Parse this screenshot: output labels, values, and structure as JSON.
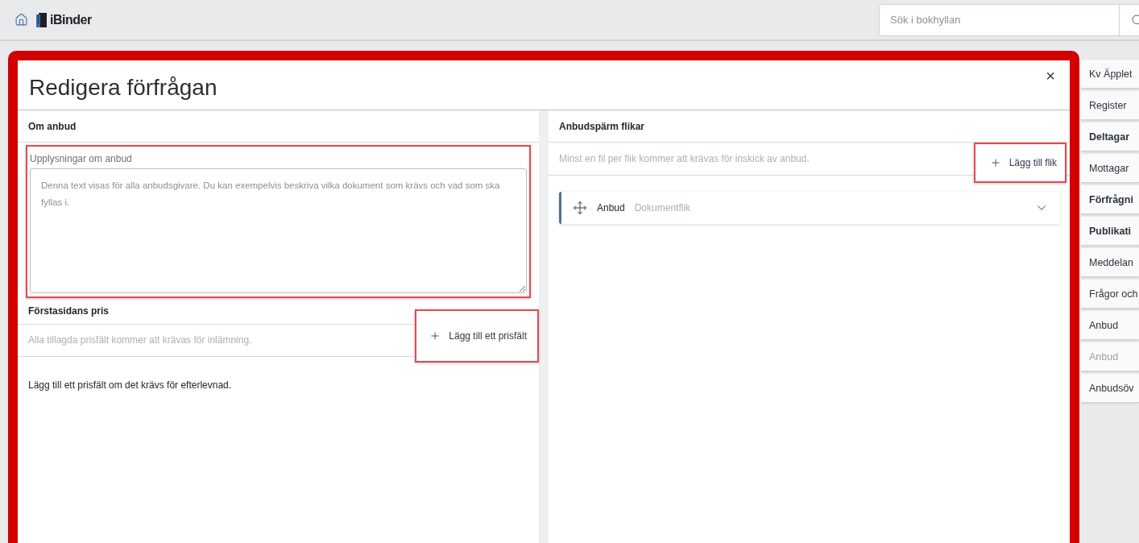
{
  "topbar": {
    "logo": "iBinder",
    "search": {
      "placeholder": "Sök i bokhyllan"
    }
  },
  "dialog": {
    "title": "Redigera förfrågan",
    "close": "×",
    "about": {
      "heading": "Om anbud",
      "field": {
        "label": "Upplysningar om anbud",
        "placeholder": "Denna text visas för alla anbudsgivare. Du kan exempelvis beskriva vilka dokument som krävs och vad som ska fyllas i.",
        "highlighted": true
      }
    },
    "price": {
      "heading": "Förstasidans pris",
      "hint": "Alla tillagda prisfält kommer att krävas för inlämning.",
      "add_button": {
        "label": "Lägg till ett prisfält",
        "highlighted": true
      },
      "empty_text": "Lägg till ett prisfält om det krävs för efterlevnad."
    },
    "binder_tabs": {
      "heading": "Anbudspärm flikar",
      "hint": "Minst en fil per flik kommer att krävas för inskick av anbud.",
      "add_button": {
        "label": "Lägg till flik",
        "highlighted": true
      },
      "tabs": [
        {
          "name": "Anbud",
          "type": "Dokumentflik",
          "expanded": false
        }
      ]
    }
  },
  "sidebar": {
    "items": [
      {
        "label": "Kv Äpplet",
        "bold": false,
        "disabled": false
      },
      {
        "label": "Register",
        "bold": false,
        "disabled": false
      },
      {
        "label": "Deltagar",
        "bold": true,
        "disabled": false
      },
      {
        "label": "Mottagar",
        "bold": false,
        "disabled": false
      },
      {
        "label": "Förfrågni",
        "bold": true,
        "disabled": false
      },
      {
        "label": "Publikati",
        "bold": true,
        "disabled": false
      },
      {
        "label": "Meddelan",
        "bold": false,
        "disabled": false
      },
      {
        "label": "Frågor och",
        "bold": false,
        "disabled": false
      },
      {
        "label": "Anbud",
        "bold": false,
        "disabled": false
      },
      {
        "label": "Anbud",
        "bold": false,
        "disabled": true
      },
      {
        "label": "Anbudsöv",
        "bold": false,
        "disabled": false
      }
    ]
  }
}
